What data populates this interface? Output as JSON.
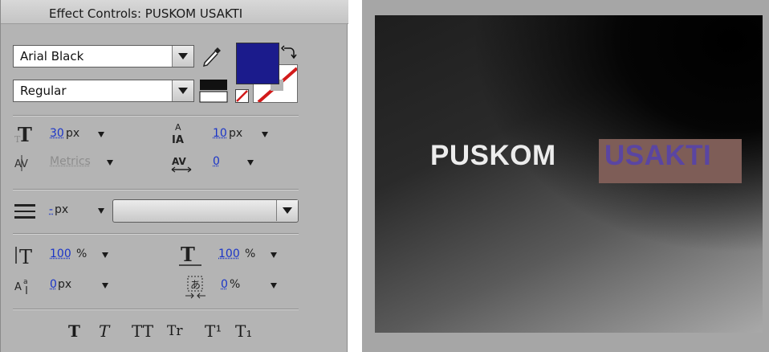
{
  "panel": {
    "title": "Effect Controls: PUSKOM USAKTI",
    "font_family": "Arial Black",
    "font_style": "Regular",
    "fill_color": "#1b1b8c",
    "stroke_color": "#ffffff",
    "font_size_value": "30",
    "font_size_unit": "px",
    "leading_value": "10",
    "leading_unit": "px",
    "kerning_value": "Metrics",
    "tracking_value": "0",
    "stroke_width_value": "-",
    "stroke_width_unit": "px",
    "vertical_scale_value": "100",
    "vertical_scale_unit": "%",
    "horizontal_scale_value": "100",
    "horizontal_scale_unit": "%",
    "baseline_shift_value": "0",
    "baseline_shift_unit": "px",
    "tsume_value": "0",
    "tsume_unit": "%",
    "style_buttons": {
      "faux_bold": "T",
      "faux_italic": "T",
      "all_caps": "TT",
      "small_caps": "Tr",
      "superscript": "T¹",
      "subscript": "T₁"
    }
  },
  "preview": {
    "text_part1": "PUSKOM",
    "text_part2": "USAKTI"
  }
}
